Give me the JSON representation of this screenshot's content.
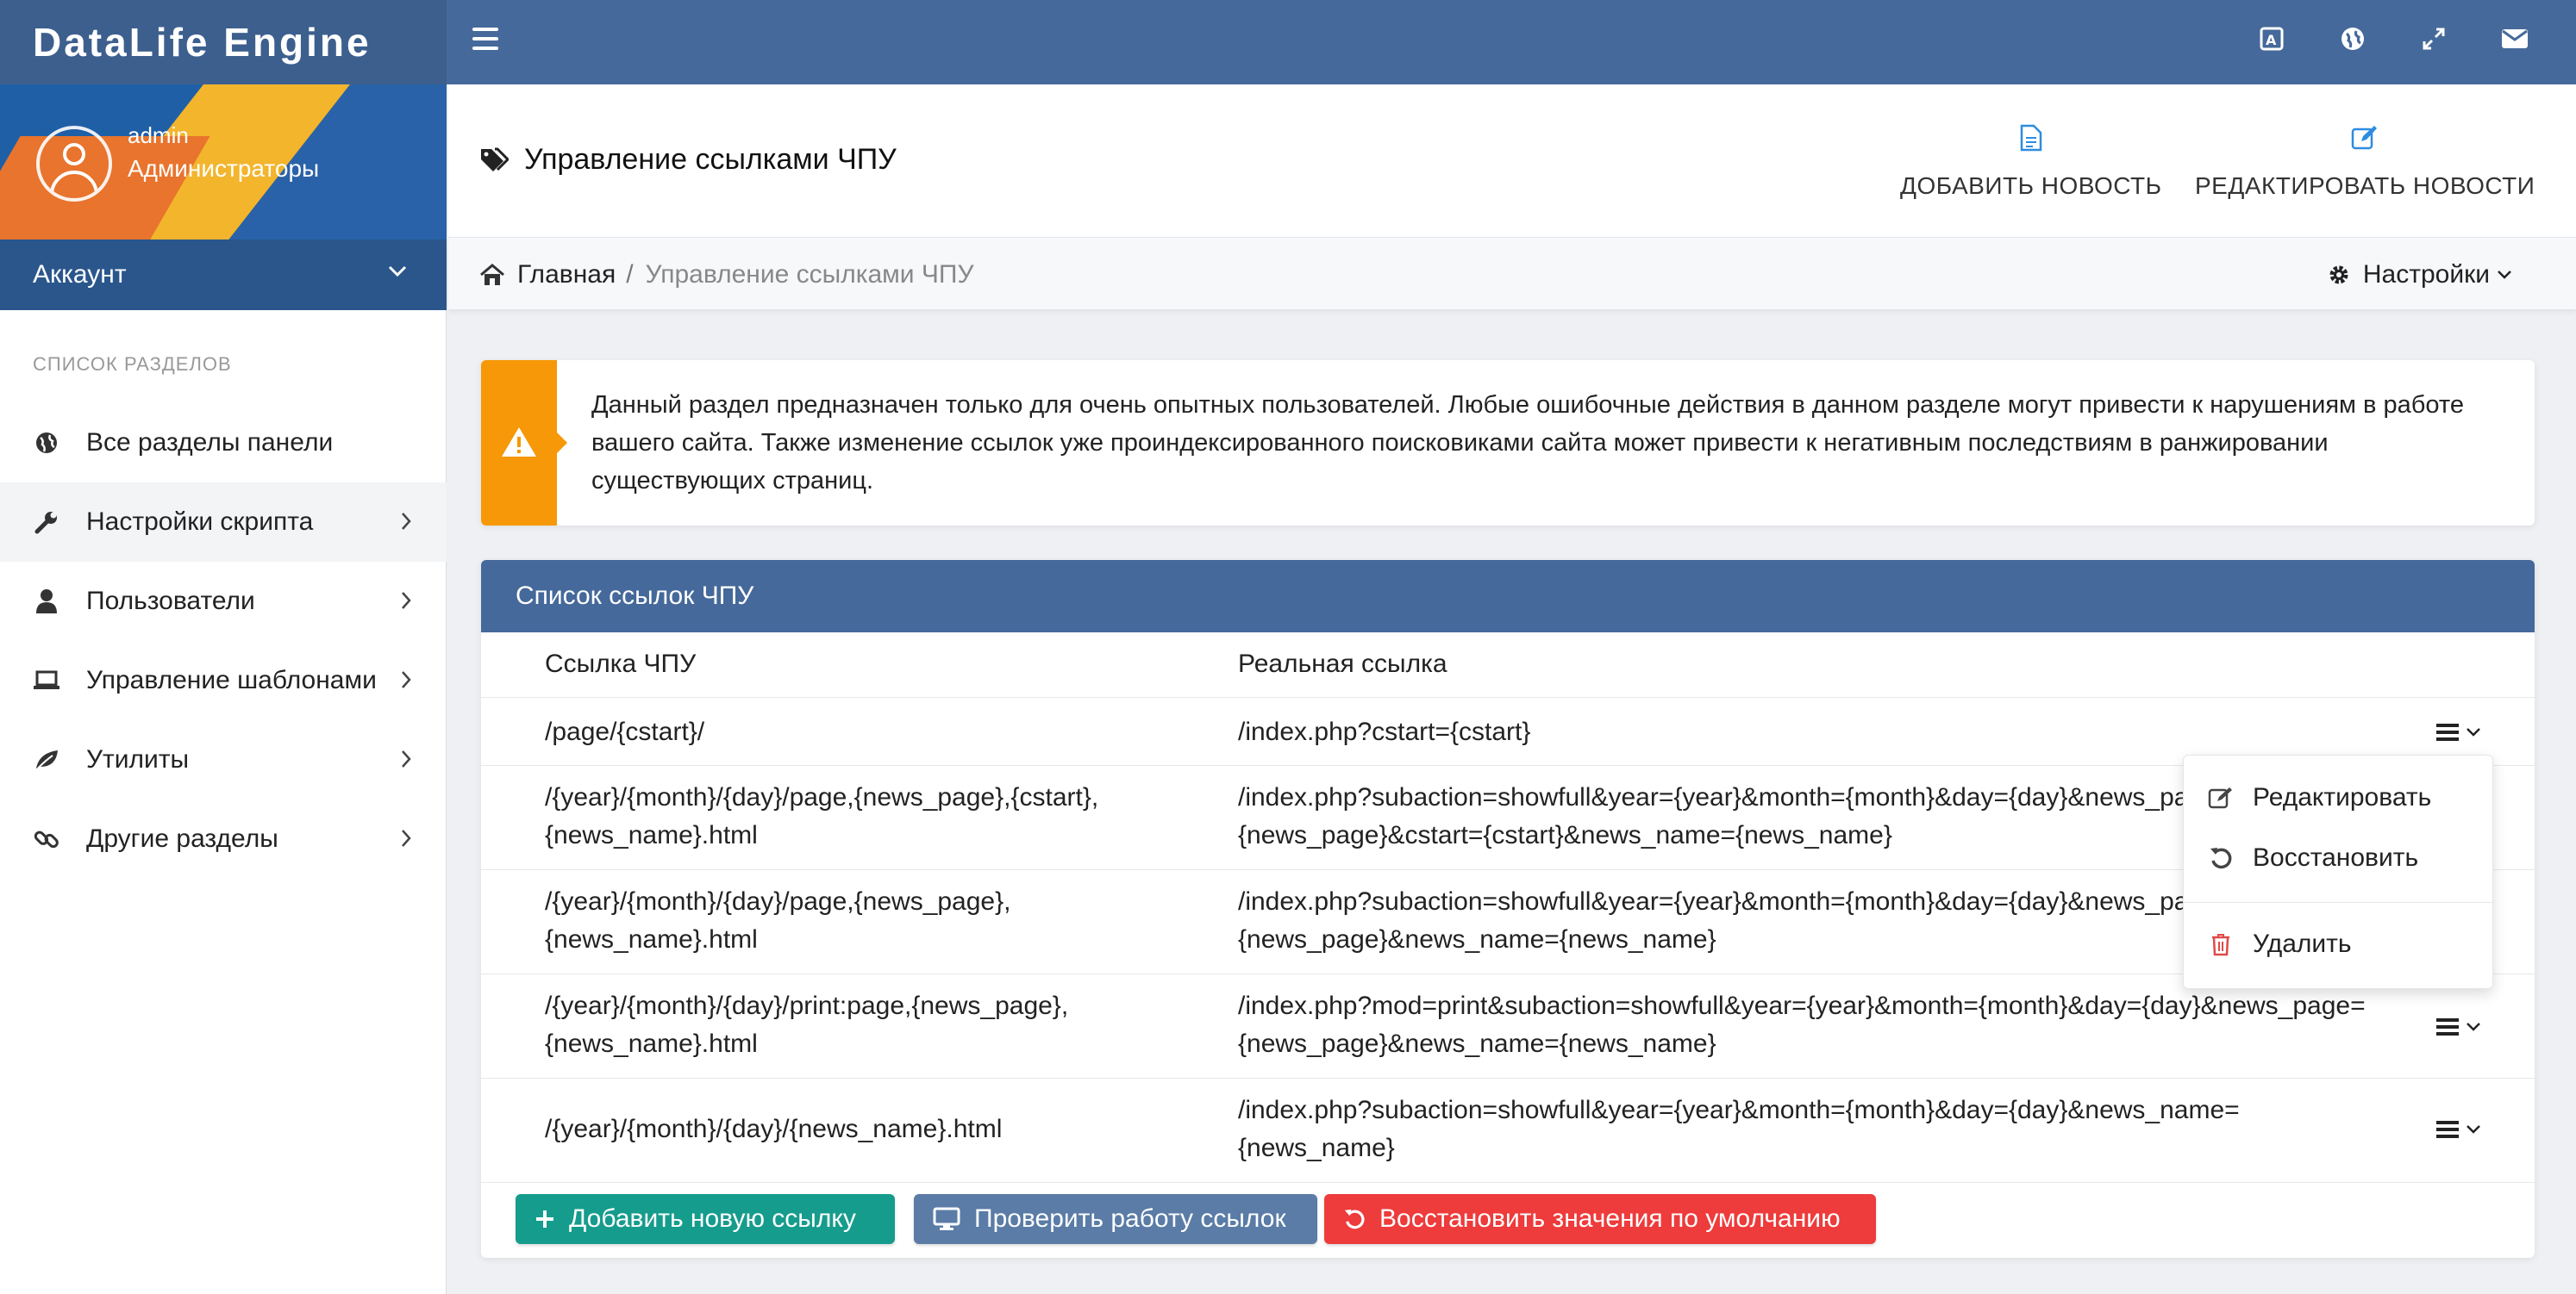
{
  "brand": "DataLife Engine",
  "topbar": {
    "icons": [
      "translate-icon",
      "globe-icon",
      "fullscreen-icon",
      "mail-icon"
    ]
  },
  "profile": {
    "username": "admin",
    "group": "Администраторы",
    "account_label": "Аккаунт"
  },
  "sidebar": {
    "section_title": "СПИСОК РАЗДЕЛОВ",
    "items": [
      {
        "label": "Все разделы панели",
        "icon": "globe-icon"
      },
      {
        "label": "Настройки скрипта",
        "icon": "wrench-icon"
      },
      {
        "label": "Пользователи",
        "icon": "user-icon"
      },
      {
        "label": "Управление шаблонами",
        "icon": "laptop-icon"
      },
      {
        "label": "Утилиты",
        "icon": "leaf-icon"
      },
      {
        "label": "Другие разделы",
        "icon": "link-icon"
      }
    ]
  },
  "header": {
    "title": "Управление ссылками ЧПУ",
    "add_news": "ДОБАВИТЬ НОВОСТЬ",
    "edit_news": "РЕДАКТИРОВАТЬ НОВОСТИ"
  },
  "breadcrumb": {
    "home": "Главная",
    "separator": "/",
    "current": "Управление ссылками ЧПУ",
    "settings": "Настройки"
  },
  "alert": {
    "text": "Данный раздел предназначен только для очень опытных пользователей. Любые ошибочные действия в данном разделе могут привести к нарушениям в работе вашего сайта. Также изменение ссылок уже проиндексированного поисковиками сайта может привести к негативным последствиям в ранжировании существующих страниц.",
    "color": "#f69807"
  },
  "panel": {
    "title": "Список ссылок ЧПУ",
    "columns": [
      "Ссылка ЧПУ",
      "Реальная ссылка"
    ],
    "rows": [
      {
        "seo": "/page/{cstart}/",
        "real": "/index.php?cstart={cstart}"
      },
      {
        "seo": "/{year}/{month}/{day}/page,{news_page},{cstart},\n{news_name}.html",
        "real": "/index.php?subaction=showfull&year={year}&month={month}&day={day}&news_page=\n{news_page}&cstart={cstart}&news_name={news_name}"
      },
      {
        "seo": "/{year}/{month}/{day}/page,{news_page},\n{news_name}.html",
        "real": "/index.php?subaction=showfull&year={year}&month={month}&day={day}&news_page=\n{news_page}&news_name={news_name}"
      },
      {
        "seo": "/{year}/{month}/{day}/print:page,{news_page},\n{news_name}.html",
        "real": "/index.php?mod=print&subaction=showfull&year={year}&month={month}&day={day}&news_page=\n{news_page}&news_name={news_name}"
      },
      {
        "seo": "/{year}/{month}/{day}/{news_name}.html",
        "real": "/index.php?subaction=showfull&year={year}&month={month}&day={day}&news_name=\n{news_name}"
      }
    ]
  },
  "dropdown": {
    "edit": "Редактировать",
    "restore": "Восстановить",
    "delete": "Удалить"
  },
  "buttons": {
    "add_link": "Добавить новую ссылку",
    "check_links": "Проверить работу ссылок",
    "restore_defaults": "Восстановить значения по умолчанию"
  },
  "colors": {
    "navbar": "#45699a",
    "green": "#169c8c",
    "blue": "#5a7ca6",
    "red": "#ee3b3b"
  }
}
